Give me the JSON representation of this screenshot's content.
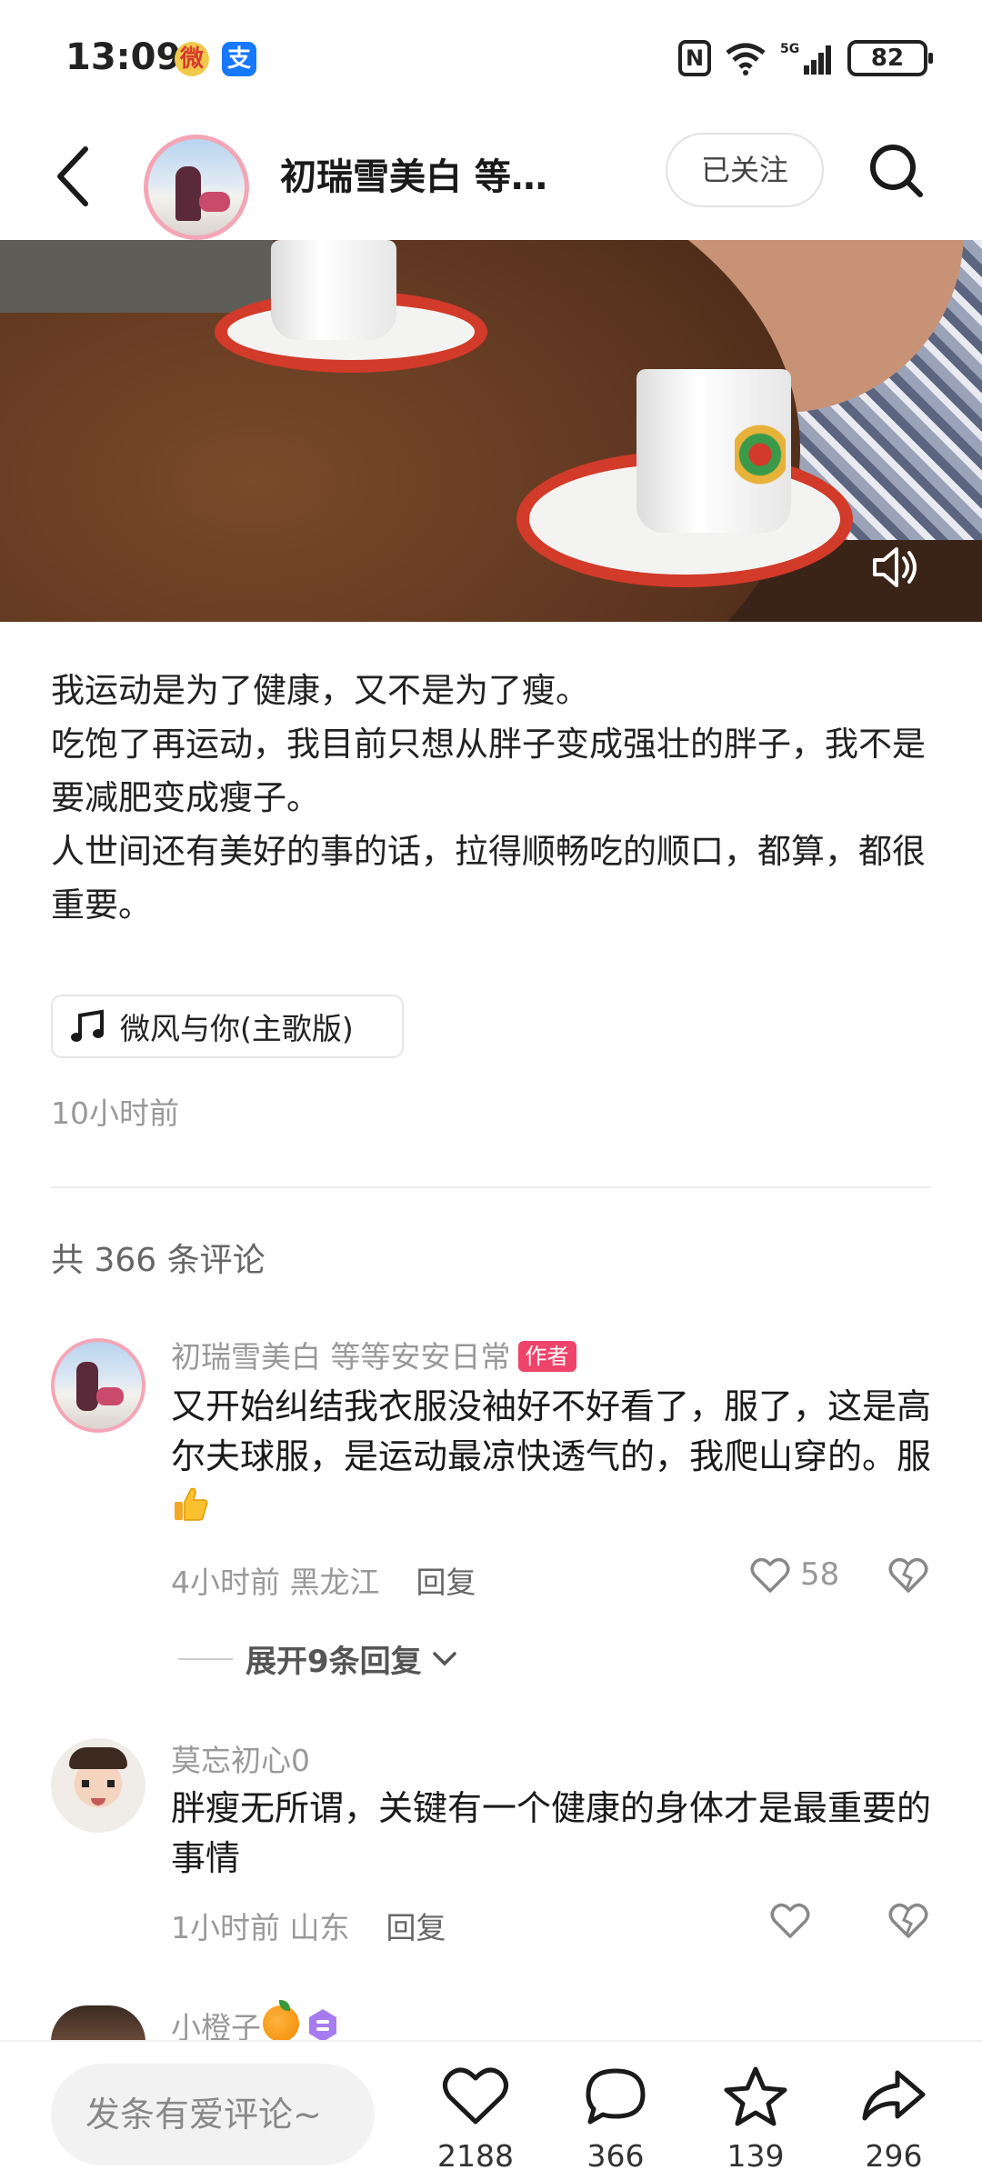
{
  "status_bar": {
    "time": "13:09",
    "weibo_badge": "微",
    "alipay_badge": "支",
    "nfc": "N",
    "battery": "82"
  },
  "header": {
    "title": "初瑞雪美白 等等...",
    "follow_label": "已关注"
  },
  "post": {
    "lines": [
      "我运动是为了健康，又不是为了瘦。",
      "吃饱了再运动，我目前只想从胖子变成强壮的胖子，我不是要减肥变成瘦子。",
      "人世间还有美好的事的话，拉得顺畅吃的顺口，都算，都很重要。"
    ],
    "music": "微风与你(主歌版)",
    "time": "10小时前"
  },
  "comments_header": "共 366 条评论",
  "comments": [
    {
      "name": "初瑞雪美白 等等安安日常",
      "tag": "作者",
      "text": "又开始纠结我衣服没袖好不好看了，服了，这是高尔夫球服，是运动最凉快透气的，我爬山穿的。服",
      "meta": "4小时前  黑龙江",
      "reply": "回复",
      "likes": "58",
      "expand": "展开9条回复"
    },
    {
      "name": "莫忘初心0",
      "text": "胖瘦无所谓，关键有一个健康的身体才是最重要的事情",
      "meta": "1小时前  山东",
      "reply": "回复"
    },
    {
      "name": "小橙子"
    }
  ],
  "bottom_bar": {
    "input_placeholder": "发条有爱评论~",
    "likes": "2188",
    "comments": "366",
    "favorites": "139",
    "shares": "296"
  },
  "colors": {
    "author_tag": "#f0436a",
    "avatar_ring": "#f4a6b6"
  }
}
